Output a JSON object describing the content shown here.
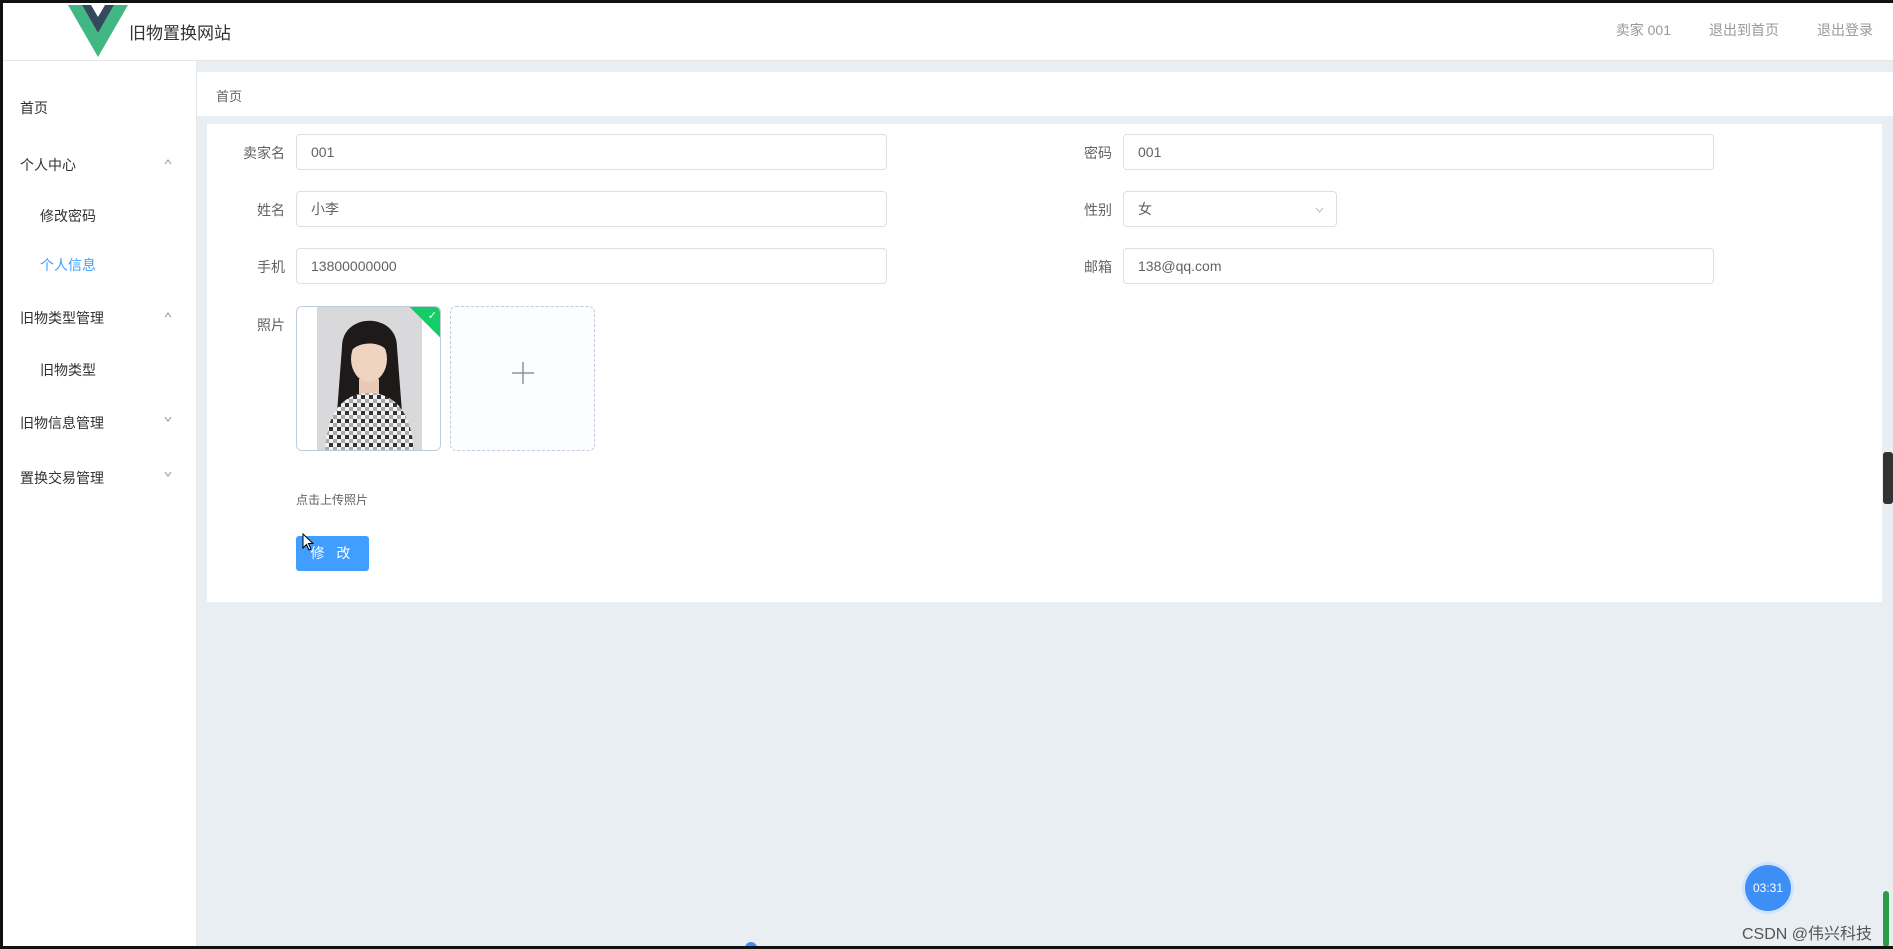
{
  "header": {
    "site_title": "旧物置换网站",
    "user": "卖家 001",
    "back_home": "退出到首页",
    "logout": "退出登录",
    "logo_colors": [
      "#41b883",
      "#34495e"
    ]
  },
  "sidebar": {
    "home": "首页",
    "personal_center": "个人中心",
    "change_password": "修改密码",
    "personal_info": "个人信息",
    "category_mgmt": "旧物类型管理",
    "category": "旧物类型",
    "item_mgmt": "旧物信息管理",
    "trade_mgmt": "置换交易管理"
  },
  "breadcrumb": {
    "home": "首页"
  },
  "form": {
    "seller_name_label": "卖家名",
    "seller_name_value": "001",
    "password_label": "密码",
    "password_value": "001",
    "name_label": "姓名",
    "name_value": "小李",
    "gender_label": "性别",
    "gender_value": "女",
    "phone_label": "手机",
    "phone_value": "13800000000",
    "email_label": "邮箱",
    "email_value": "138@qq.com",
    "photo_label": "照片",
    "upload_hint": "点击上传照片",
    "submit_label": "修 改"
  },
  "widgets": {
    "timer": "03:31",
    "watermark": "CSDN @伟兴科技"
  },
  "colors": {
    "accent": "#409eff",
    "success": "#13ce66",
    "page_bg": "#e9eef3"
  }
}
